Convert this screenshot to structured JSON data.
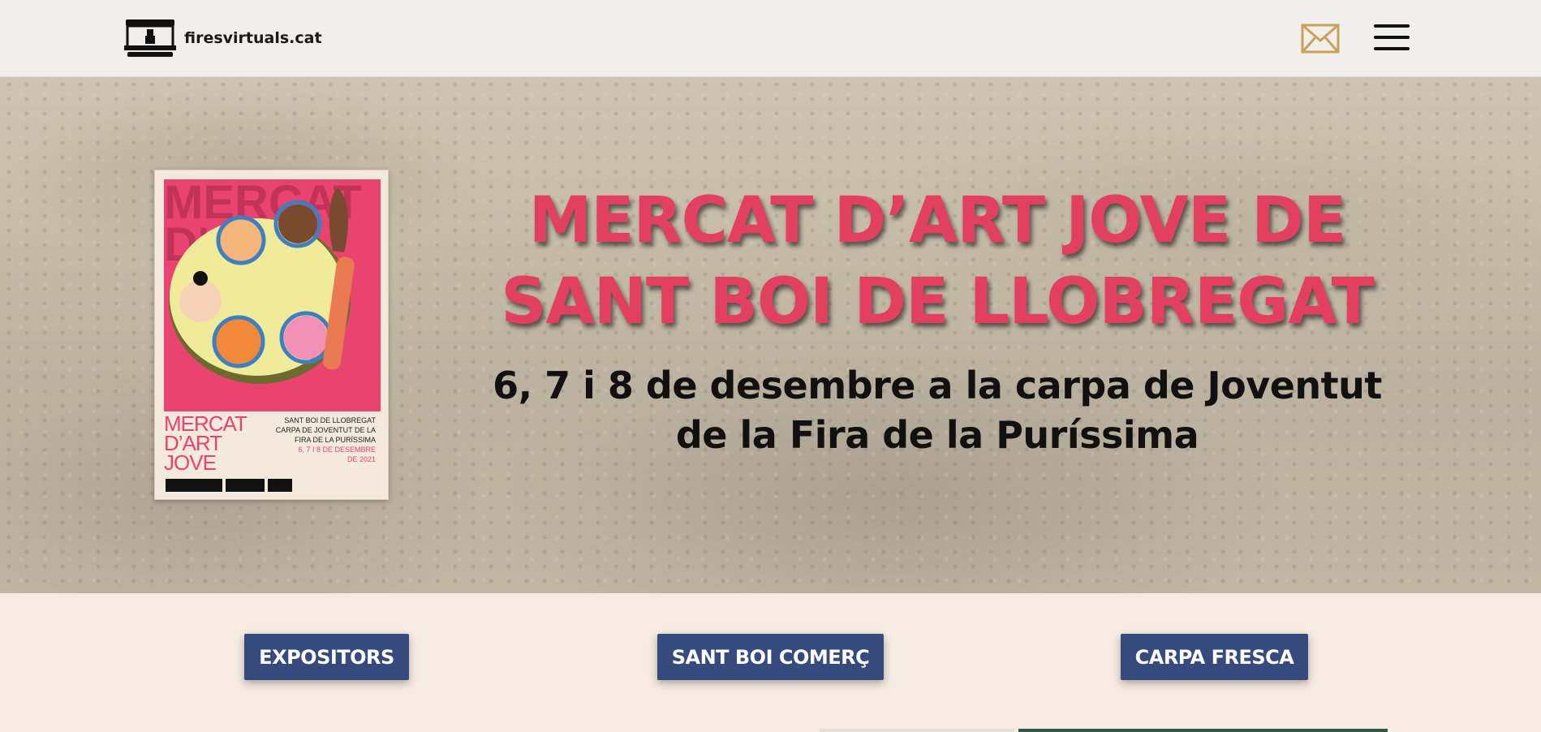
{
  "header": {
    "site_name": "firesvirtuals.cat",
    "logo_icon": "market-stall-icon",
    "mail_icon": "envelope-icon",
    "menu_icon": "hamburger-menu-icon"
  },
  "hero": {
    "title": "MERCAT D’ART JOVE DE\nSANT BOI DE LLOBREGAT",
    "subtitle": "6, 7 i 8 de desembre a la carpa de Joventut\nde la Fira de la Puríssima",
    "poster": {
      "title": "MERCAT\nD’ART\nJOVE",
      "info": "SANT BOI DE LLOBREGAT\nCARPA DE JOVENTUT DE LA\nFIRA DE LA PURÍSSIMA",
      "dates": "6, 7 I 8 DE DESEMBRE\nDE 2021"
    }
  },
  "buttons": [
    {
      "label": "EXPOSITORS"
    },
    {
      "label": "SANT BOI COMERÇ"
    },
    {
      "label": "CARPA FRESCA"
    }
  ],
  "colors": {
    "accent_pink": "#e3405f",
    "button_blue": "#364a7e",
    "mail_gold": "#c9a15a",
    "page_background": "#f5ebe0"
  }
}
